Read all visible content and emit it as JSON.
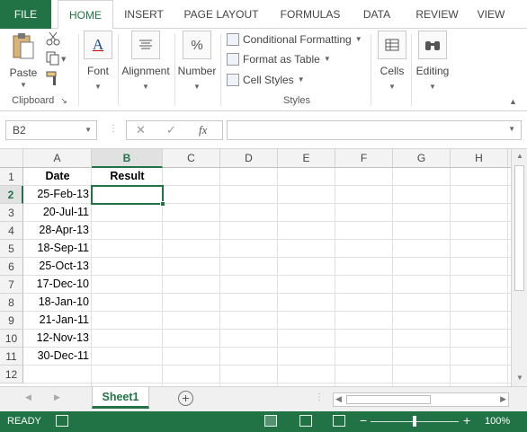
{
  "tabs": {
    "file": "FILE",
    "items": [
      "HOME",
      "INSERT",
      "PAGE LAYOUT",
      "FORMULAS",
      "DATA",
      "REVIEW",
      "VIEW"
    ]
  },
  "ribbon": {
    "clipboard": {
      "paste": "Paste",
      "group": "Clipboard"
    },
    "font": "Font",
    "alignment": "Alignment",
    "number": "Number",
    "styles": {
      "conditional": "Conditional Formatting",
      "format_table": "Format as Table",
      "cell_styles": "Cell Styles",
      "group": "Styles"
    },
    "cells": "Cells",
    "editing": "Editing"
  },
  "formula_bar": {
    "name_box": "B2",
    "cancel": "✕",
    "enter": "✓",
    "fx": "fx",
    "formula": ""
  },
  "columns": [
    "A",
    "B",
    "C",
    "D",
    "E",
    "F",
    "G",
    "H"
  ],
  "rows": [
    "1",
    "2",
    "3",
    "4",
    "5",
    "6",
    "7",
    "8",
    "9",
    "10",
    "11",
    "12"
  ],
  "sheet": {
    "header_date": "Date",
    "header_result": "Result",
    "dates": [
      "25-Feb-13",
      "20-Jul-11",
      "28-Apr-13",
      "18-Sep-11",
      "25-Oct-13",
      "17-Dec-10",
      "18-Jan-10",
      "21-Jan-11",
      "12-Nov-13",
      "30-Dec-11"
    ]
  },
  "sheet_tabs": {
    "active": "Sheet1",
    "add": "+"
  },
  "status": {
    "ready": "READY",
    "zoom": "100%",
    "zoom_out": "−",
    "zoom_in": "+"
  },
  "colors": {
    "accent": "#217346"
  }
}
